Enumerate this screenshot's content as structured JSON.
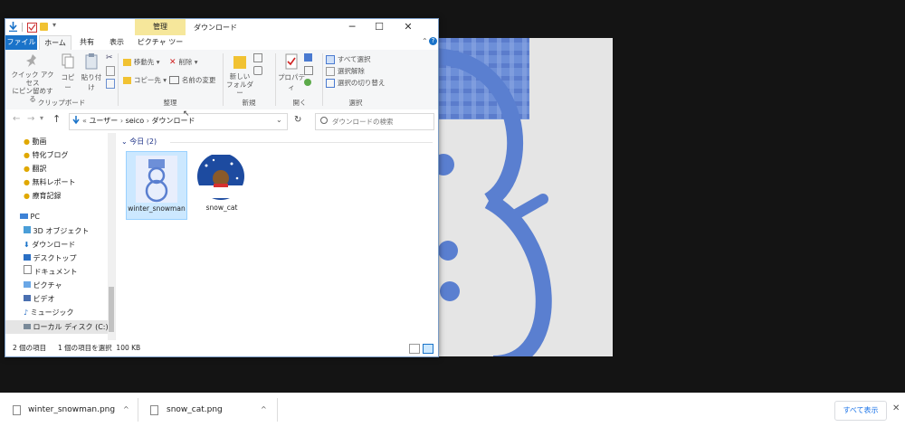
{
  "window": {
    "context_tab": "管理",
    "title": "ダウンロード"
  },
  "ribbon_tabs": [
    "ファイル",
    "ホーム",
    "共有",
    "表示",
    "ピクチャ ツール"
  ],
  "ribbon": {
    "quick_access": "クイック アクセス\nにピン留めする",
    "copy": "コピー",
    "paste": "貼り付け",
    "clipboard_group": "クリップボード",
    "move_to": "移動先",
    "copy_to": "コピー先",
    "delete": "削除",
    "rename": "名前の変更",
    "organize_group": "整理",
    "new_folder": "新しい\nフォルダー",
    "new_group": "新規",
    "properties": "プロパティ",
    "open_group": "開く",
    "select_all": "すべて選択",
    "select_none": "選択解除",
    "invert_selection": "選択の切り替え",
    "select_group": "選択"
  },
  "address": {
    "path": [
      "ユーザー",
      "seico",
      "ダウンロード"
    ],
    "search_placeholder": "ダウンロードの検索"
  },
  "nav_items": [
    {
      "label": "動画",
      "icon": "pin-icon"
    },
    {
      "label": "特化ブログ",
      "icon": "pin-icon"
    },
    {
      "label": "翻訳",
      "icon": "pin-icon"
    },
    {
      "label": "無料レポート",
      "icon": "pin-icon"
    },
    {
      "label": "療育記録",
      "icon": "pin-icon"
    },
    {
      "label": "PC",
      "icon": "pc-icon"
    },
    {
      "label": "3D オブジェクト",
      "icon": "3d-objects-icon"
    },
    {
      "label": "ダウンロード",
      "icon": "download-icon"
    },
    {
      "label": "デスクトップ",
      "icon": "desktop-icon"
    },
    {
      "label": "ドキュメント",
      "icon": "document-icon"
    },
    {
      "label": "ピクチャ",
      "icon": "picture-icon"
    },
    {
      "label": "ビデオ",
      "icon": "video-icon"
    },
    {
      "label": "ミュージック",
      "icon": "music-icon"
    },
    {
      "label": "ローカル ディスク (C:)",
      "icon": "disk-icon"
    }
  ],
  "content": {
    "group_header": "今日 (2)",
    "files": [
      {
        "name": "winter_snowman",
        "selected": true
      },
      {
        "name": "snow_cat",
        "selected": false
      }
    ]
  },
  "status": {
    "count": "2 個の項目",
    "selected": "1 個の項目を選択  100 KB"
  },
  "downloads": {
    "items": [
      "winter_snowman.png",
      "snow_cat.png"
    ],
    "show_all": "すべて表示"
  },
  "colors": {
    "accent": "#1a73c9",
    "selection": "#cce8ff",
    "snowman_blue": "#5a7fd0"
  }
}
